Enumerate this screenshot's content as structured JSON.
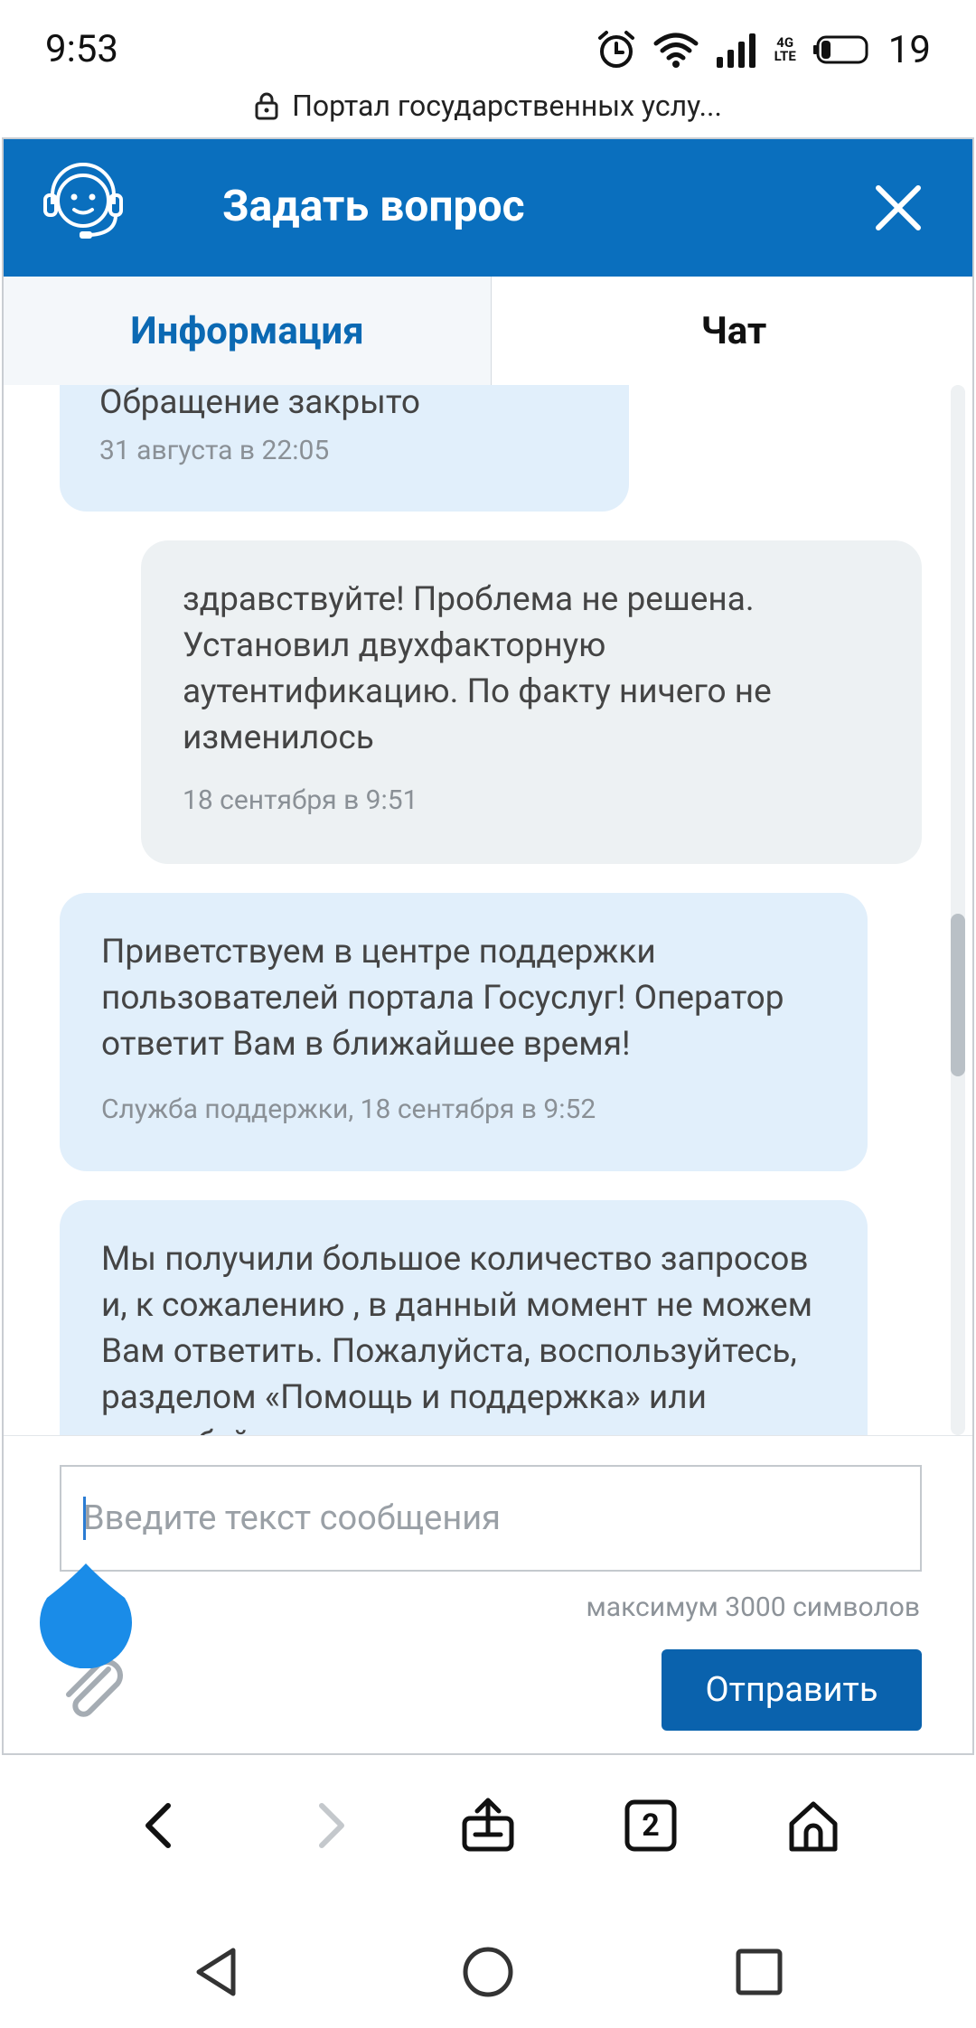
{
  "status_bar": {
    "time": "9:53",
    "battery": "19",
    "network_top": "4G",
    "network_bottom": "LTE",
    "icons": [
      "alarm-icon",
      "wifi-icon",
      "signal-icon",
      "battery-icon"
    ]
  },
  "url_bar": {
    "url_text": "Портал государственных услу..."
  },
  "dialog": {
    "title": "Задать вопрос",
    "tabs": [
      {
        "label": "Информация",
        "active": false
      },
      {
        "label": "Чат",
        "active": true
      }
    ],
    "messages": [
      {
        "sender": "support",
        "text": "Обращение закрыто",
        "meta": "31 августа в 22:05"
      },
      {
        "sender": "user",
        "text": "здравствуйте! Проблема не решена. Установил двухфакторную аутентификацию. По факту ничего не изменилось",
        "meta": "18 сентября в 9:51"
      },
      {
        "sender": "support",
        "text": "Приветствуем в центре поддержки пользователей портала Госуслуг! Оператор ответит Вам в ближайшее время!",
        "meta": "Служба поддержки, 18 сентября в 9:52"
      },
      {
        "sender": "support",
        "text": "Мы получили большое количество запросов и, к сожалению , в данный момент не можем Вам ответить. Пожалуйста, воспользуйтесь, разделом «Помощь и поддержка» или попробуйте",
        "meta": ""
      }
    ],
    "composer": {
      "placeholder": "Введите текст сообщения",
      "max_chars": "максимум 3000 символов",
      "send_label": "Отправить"
    }
  },
  "browser_toolbar": {
    "tab_count": "2"
  },
  "colors": {
    "header_blue": "#0a6fbe",
    "send_blue": "#0a62ad",
    "support_bubble": "#e1effb",
    "user_bubble": "#edf1f3",
    "active_tab_text": "#0b69b3"
  }
}
